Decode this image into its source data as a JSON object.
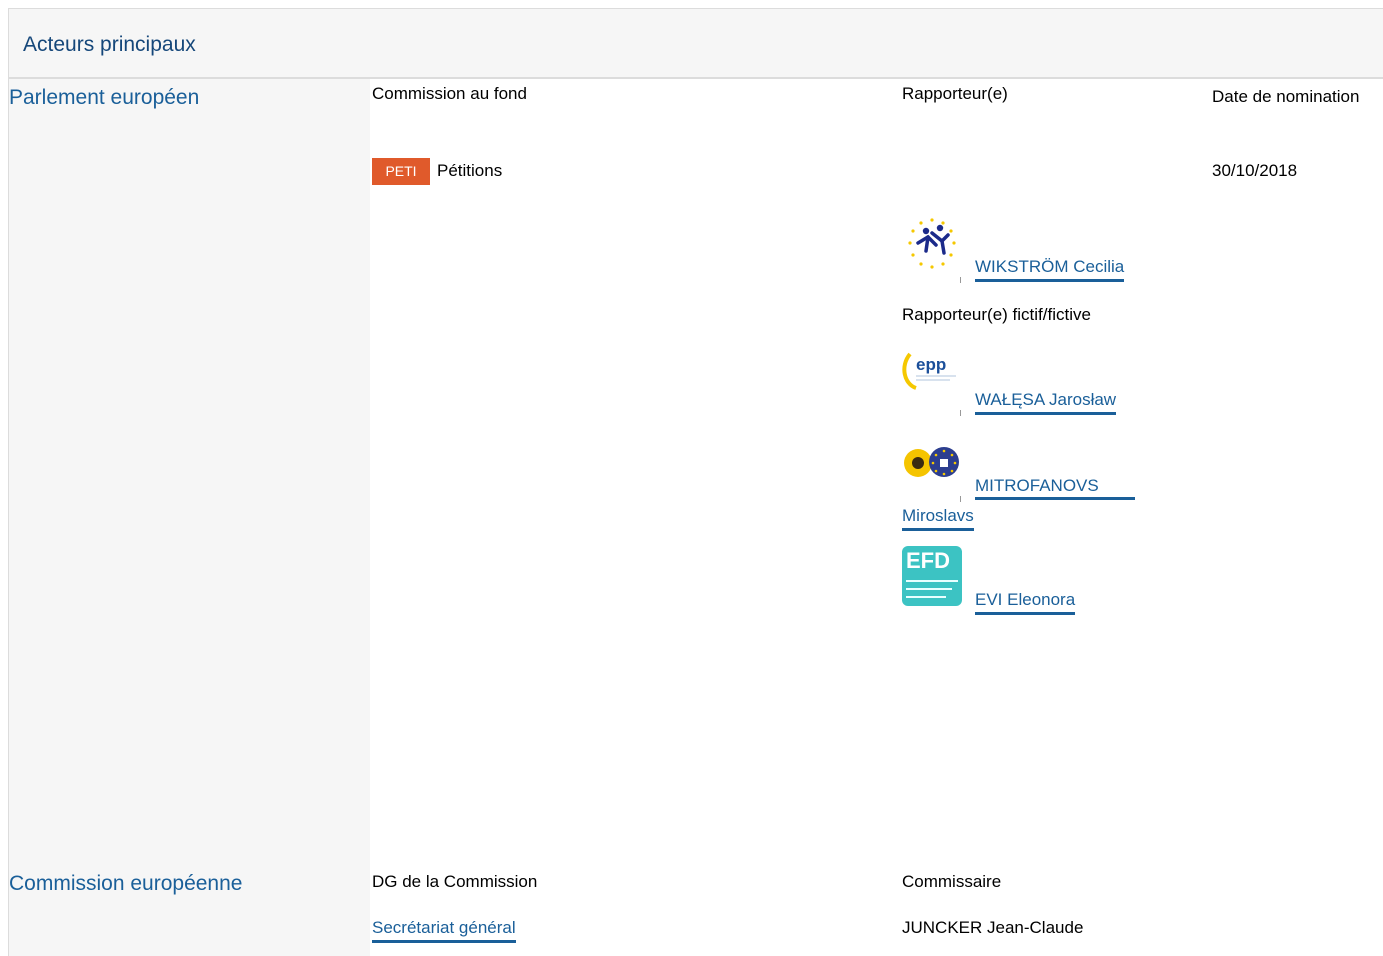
{
  "header": {
    "title": "Acteurs principaux"
  },
  "parliament": {
    "label": "Parlement européen",
    "col_committee": "Commission au fond",
    "col_rapporteur": "Rapporteur(e)",
    "col_date": "Date de nomination",
    "committee_code": "PETI",
    "committee_name": "Pétitions",
    "appointment_date": "30/10/2018",
    "rapporteur": {
      "name": "WIKSTRÖM Cecilia",
      "logo_icon": "alde-logo-icon"
    },
    "shadow_label": "Rapporteur(e) fictif/fictive",
    "shadows": [
      {
        "name": "WAŁĘSA Jarosław",
        "logo_icon": "epp-logo-icon"
      },
      {
        "name_line1": "MITROFANOVS",
        "name_line2": "Miroslavs",
        "logo_icon": "greens-efa-logo-icon"
      },
      {
        "name": "EVI Eleonora",
        "logo_icon": "efdd-logo-icon",
        "logo_text": "EFD"
      }
    ]
  },
  "commission": {
    "label": "Commission européenne",
    "col_dg": "DG de la Commission",
    "col_commissioner": "Commissaire",
    "dg": "Secrétariat général",
    "commissioner": "JUNCKER Jean-Claude"
  },
  "colors": {
    "link": "#1a5f99",
    "header_bg": "#f6f6f6",
    "badge": "#e05a2b",
    "efdd": "#3cc3c3"
  }
}
